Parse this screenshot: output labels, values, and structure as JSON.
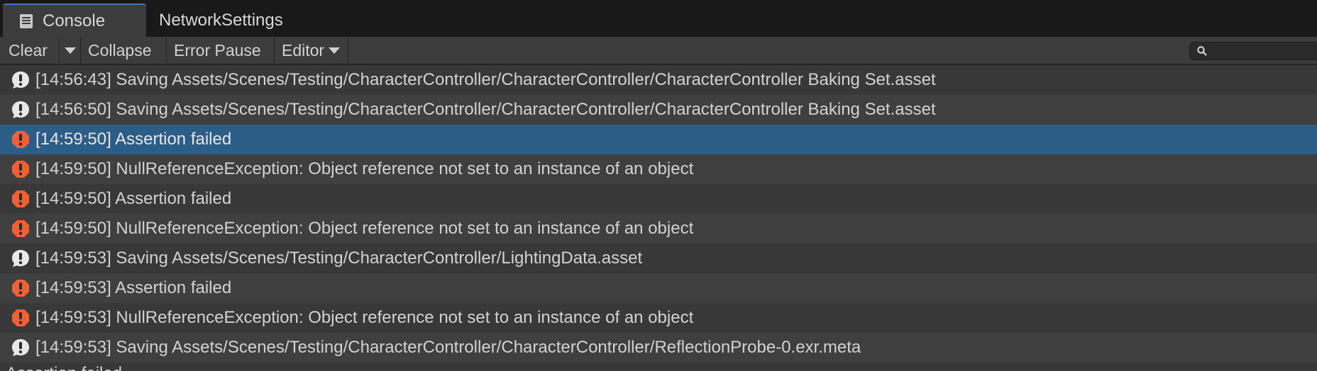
{
  "tabs": {
    "console_label": "Console",
    "network_label": "NetworkSettings"
  },
  "toolbar": {
    "clear_label": "Clear",
    "collapse_label": "Collapse",
    "error_pause_label": "Error Pause",
    "editor_label": "Editor",
    "search_placeholder": ""
  },
  "colors": {
    "selected_row": "#2c5d87",
    "error_icon": "#f06035",
    "info_icon": "#e8e8e8"
  },
  "log": {
    "entries": [
      {
        "type": "info",
        "text": "[14:56:43] Saving Assets/Scenes/Testing/CharacterController/CharacterController/CharacterController Baking Set.asset"
      },
      {
        "type": "info",
        "text": "[14:56:50] Saving Assets/Scenes/Testing/CharacterController/CharacterController/CharacterController Baking Set.asset"
      },
      {
        "type": "error",
        "text": "[14:59:50] Assertion failed",
        "selected": true
      },
      {
        "type": "error",
        "text": "[14:59:50] NullReferenceException: Object reference not set to an instance of an object"
      },
      {
        "type": "error",
        "text": "[14:59:50] Assertion failed"
      },
      {
        "type": "error",
        "text": "[14:59:50] NullReferenceException: Object reference not set to an instance of an object"
      },
      {
        "type": "info",
        "text": "[14:59:53] Saving Assets/Scenes/Testing/CharacterController/LightingData.asset"
      },
      {
        "type": "error",
        "text": "[14:59:53] Assertion failed"
      },
      {
        "type": "error",
        "text": "[14:59:53] NullReferenceException: Object reference not set to an instance of an object"
      },
      {
        "type": "info",
        "text": "[14:59:53] Saving Assets/Scenes/Testing/CharacterController/CharacterController/ReflectionProbe-0.exr.meta"
      }
    ],
    "detail_text": "Assertion failed"
  }
}
